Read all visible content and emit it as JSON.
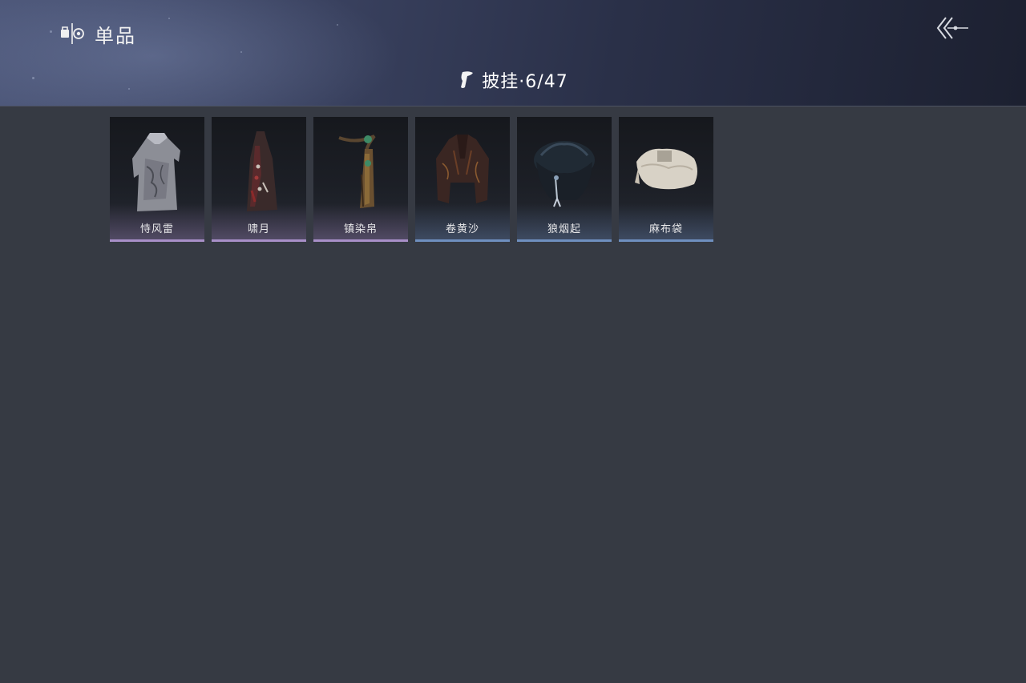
{
  "header": {
    "section_label": "单品",
    "section_icon": "wardrobe-icon",
    "back_icon": "back-arrow-icon"
  },
  "category": {
    "icon": "cape-icon",
    "label": "披挂·6/47"
  },
  "items": [
    {
      "name": "恃风雷",
      "rarity_color": "#a88fc8",
      "icon": "grey-cloak-icon"
    },
    {
      "name": "啸月",
      "rarity_color": "#a88fc8",
      "icon": "dark-red-cape-icon"
    },
    {
      "name": "镇染帛",
      "rarity_color": "#a88fc8",
      "icon": "jade-sash-icon"
    },
    {
      "name": "卷黄沙",
      "rarity_color": "#6f8fbf",
      "icon": "brown-coat-icon"
    },
    {
      "name": "狼烟起",
      "rarity_color": "#6f8fbf",
      "icon": "fur-mantle-icon"
    },
    {
      "name": "麻布袋",
      "rarity_color": "#6f8fbf",
      "icon": "cloth-sack-icon"
    }
  ]
}
